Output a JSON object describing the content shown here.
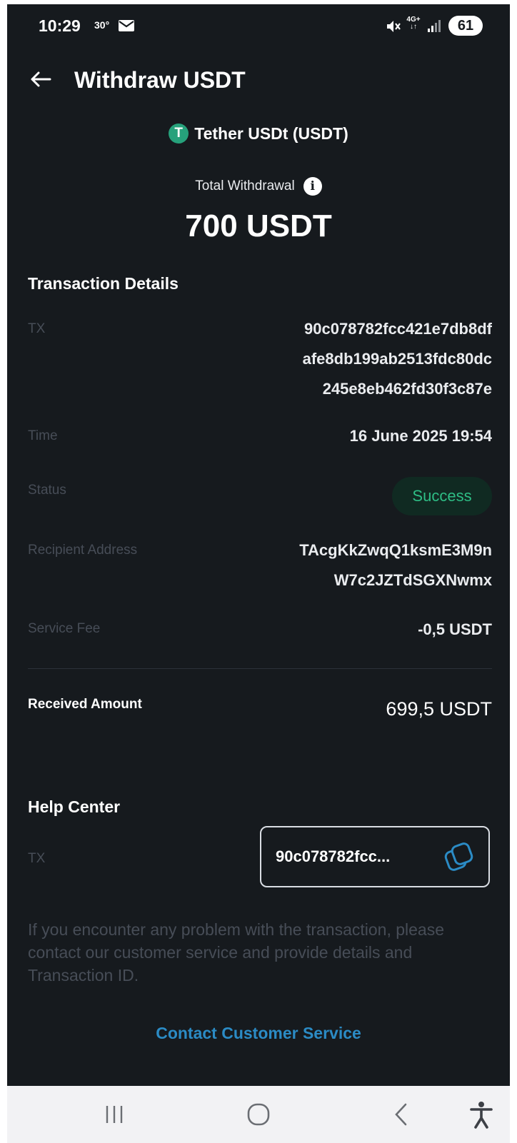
{
  "status_bar": {
    "time": "10:29",
    "temperature": "30°",
    "network": "4G+",
    "battery": "61"
  },
  "header": {
    "title": "Withdraw USDT"
  },
  "coin": {
    "name": "Tether USDt (USDT)",
    "icon_letter": "T",
    "icon_color": "#26a17b"
  },
  "total": {
    "label": "Total Withdrawal",
    "amount": "700 USDT"
  },
  "transaction_details": {
    "title": "Transaction Details",
    "tx_label": "TX",
    "tx_value_lines": [
      "90c078782fcc421e7db8df",
      "afe8db199ab2513fdc80dc",
      "245e8eb462fd30f3c87e"
    ],
    "time_label": "Time",
    "time_value": "16 June 2025 19:54",
    "status_label": "Status",
    "status_value": "Success",
    "recipient_label": "Recipient Address",
    "recipient_lines": [
      "TAcgKkZwqQ1ksmE3M9n",
      "W7c2JZTdSGXNwmx"
    ],
    "fee_label": "Service Fee",
    "fee_value": "-0,5 USDT",
    "received_label": "Received Amount",
    "received_value": "699,5 USDT"
  },
  "help_center": {
    "title": "Help Center",
    "tx_label": "TX",
    "tx_short": "90c078782fcc...",
    "note": "If you encounter any problem with the transaction, please contact our customer service and provide details and Transaction ID.",
    "contact_link": "Contact Customer Service"
  },
  "colors": {
    "background": "#161a1e",
    "success": "#2ebd85",
    "link": "#2b8bc5",
    "muted": "#474d57"
  }
}
